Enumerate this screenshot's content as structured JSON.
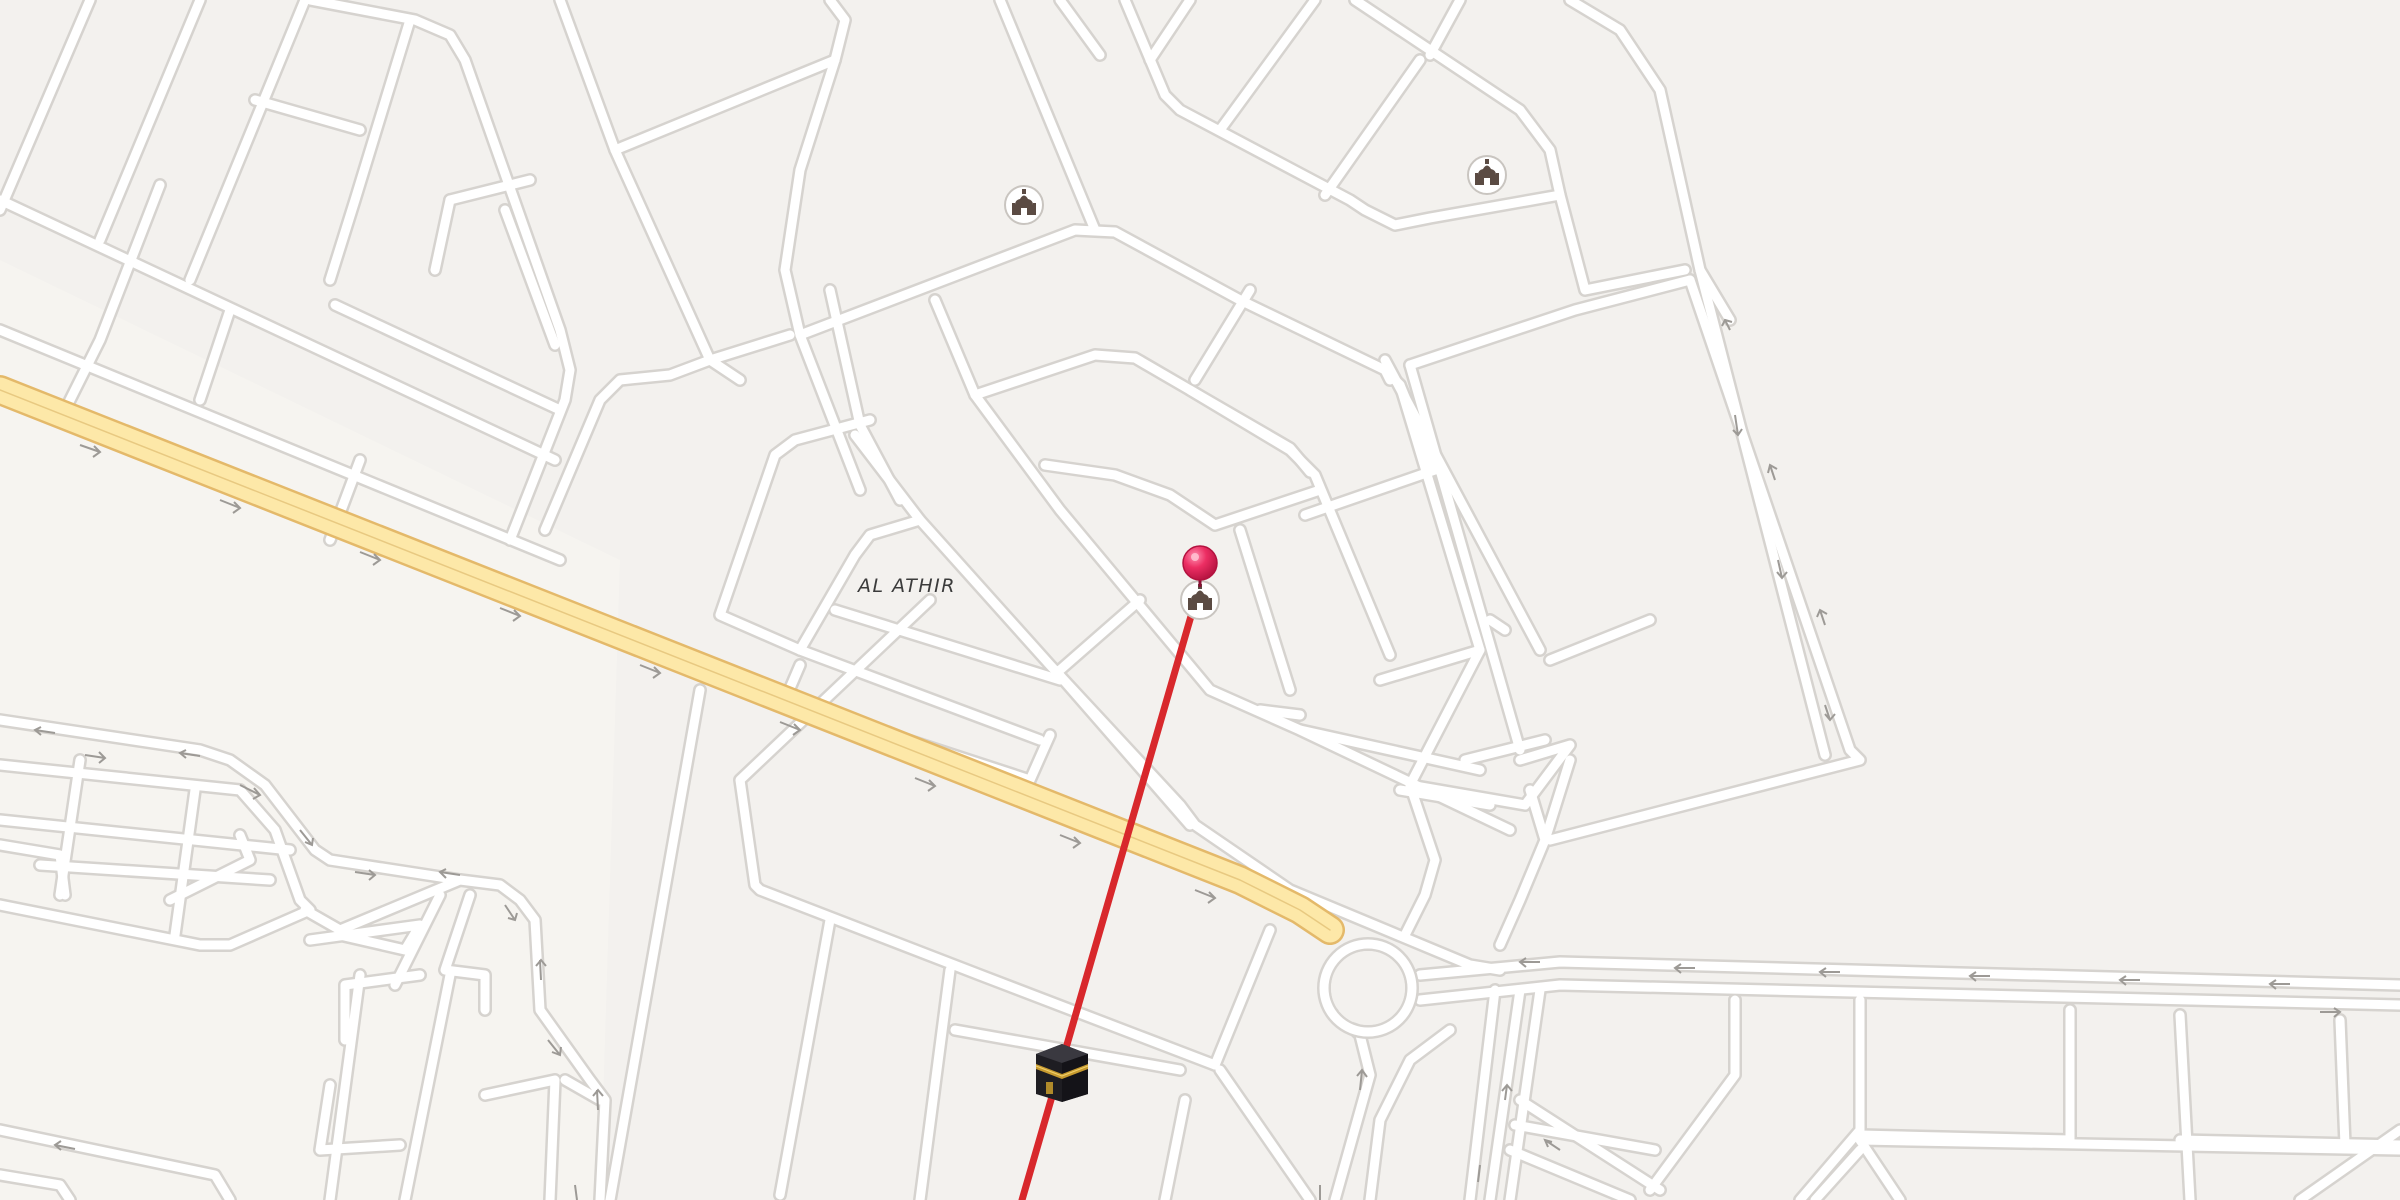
{
  "map": {
    "district_label": "AL ATHIR",
    "colors": {
      "background": "#f3f1ee",
      "road_fill": "#ffffff",
      "road_casing": "#d6d3cf",
      "highway_fill": "#fde8a8",
      "highway_casing": "#e4b96a",
      "route_line": "#d8282c",
      "pin": "#e8275a",
      "poi_icon": "#5b4b43",
      "one_way_arrow": "#9d9a96"
    },
    "markers": {
      "destination_pin": {
        "icon": "map-pin-icon"
      },
      "qibla_marker": {
        "icon": "kaaba-icon"
      },
      "mosques": [
        {
          "icon": "mosque-icon"
        },
        {
          "icon": "mosque-icon"
        },
        {
          "icon": "mosque-icon"
        }
      ]
    },
    "route": {
      "kind": "qibla-direction-line"
    }
  }
}
